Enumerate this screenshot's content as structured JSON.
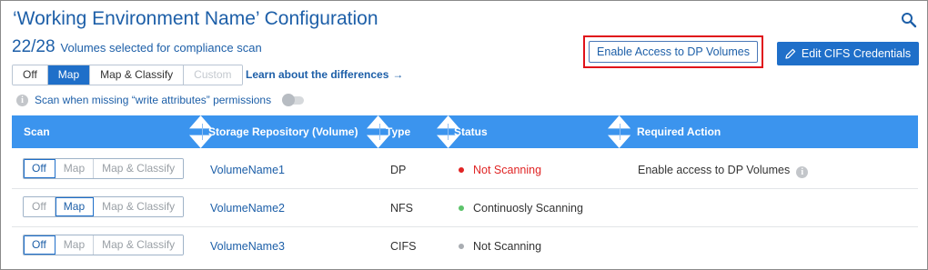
{
  "header": {
    "title": "‘Working Environment Name’ Configuration",
    "count": "22/28",
    "volumes_word": "Volumes",
    "count_suffix": " selected for compliance scan"
  },
  "icons": {
    "search": "search-icon",
    "pencil": "pencil-icon",
    "info": "info-icon",
    "sort": "sort-icon"
  },
  "mode_selector": {
    "options": [
      "Off",
      "Map",
      "Map & Classify",
      "Custom"
    ],
    "selected": "Map",
    "disabled": "Custom"
  },
  "learn_link": {
    "label": "Learn about the differences",
    "arrow": "→"
  },
  "permission_toggle": {
    "label": "Scan when missing “write attributes” permissions",
    "state": "off"
  },
  "buttons": {
    "enable_dp": "Enable Access to DP Volumes",
    "edit_cifs": "Edit CIFS Credentials"
  },
  "table": {
    "columns": [
      "Scan",
      "Storage Repository (Volume)",
      "Type",
      "Status",
      "Required Action"
    ],
    "scan_options": [
      "Off",
      "Map",
      "Map & Classify"
    ],
    "rows": [
      {
        "scan": "Off",
        "volume": "VolumeName1",
        "type": "DP",
        "status": "Not Scanning",
        "status_color": "#e02424",
        "action": "Enable access to DP Volumes"
      },
      {
        "scan": "Map",
        "volume": "VolumeName2",
        "type": "NFS",
        "status": "Continuosly Scanning",
        "status_color": "#5cc36b",
        "action": ""
      },
      {
        "scan": "Off",
        "volume": "VolumeName3",
        "type": "CIFS",
        "status": "Not Scanning",
        "status_color": "#a9adb2",
        "action": ""
      }
    ]
  },
  "colors": {
    "brand_blue": "#1d5fa8",
    "primary_button": "#1f6fc9",
    "table_header": "#3b94ee",
    "highlight_box": "#e0121a",
    "status_red": "#e02424",
    "status_green": "#5cc36b",
    "status_gray": "#a9adb2"
  }
}
